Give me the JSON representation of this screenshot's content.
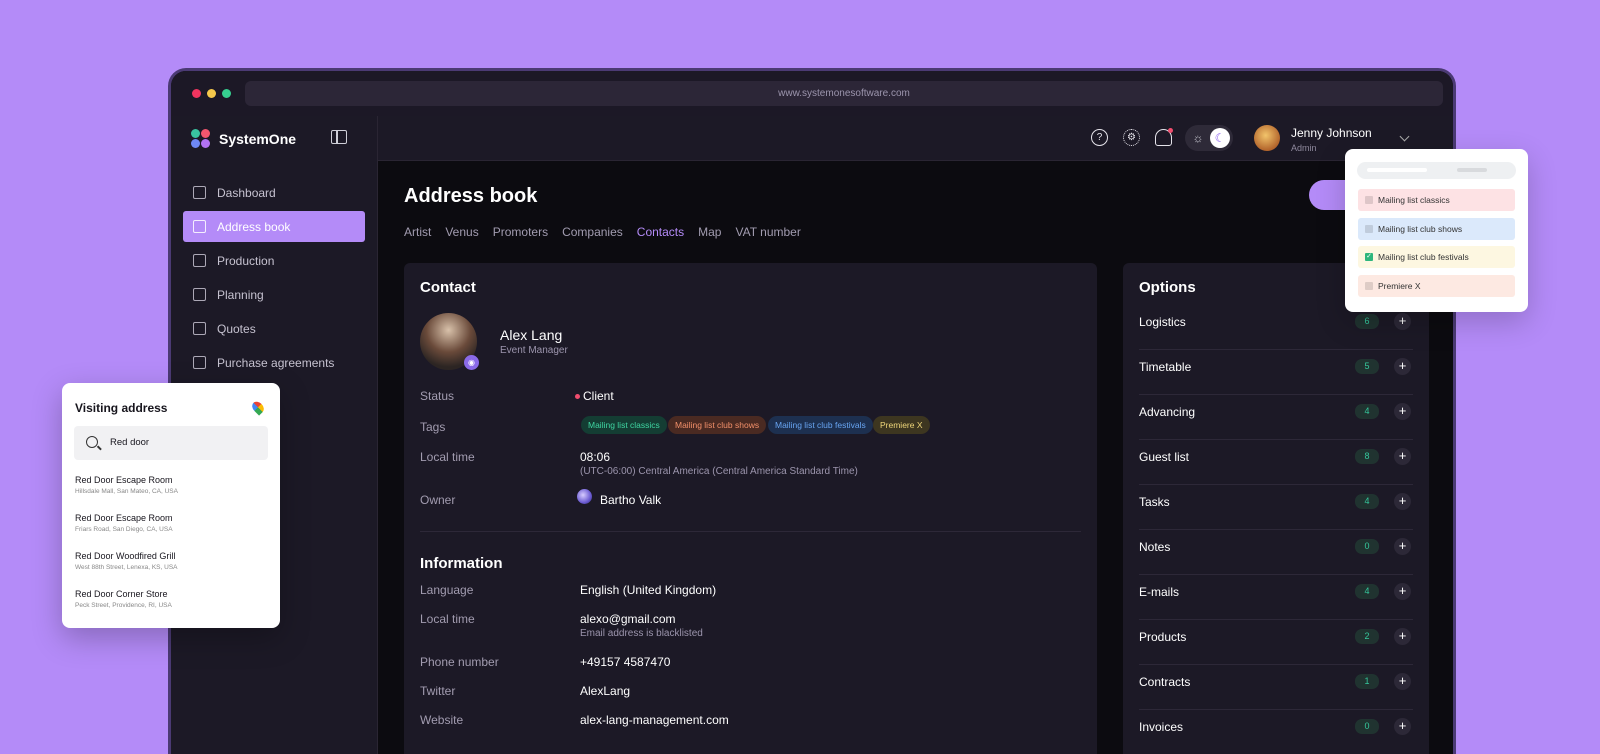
{
  "browser": {
    "url": "www.systemonesoftware.com"
  },
  "app": {
    "name": "SystemOne"
  },
  "sidebar": {
    "items": [
      {
        "label": "Dashboard",
        "icon": "dashboard-icon"
      },
      {
        "label": "Address book",
        "icon": "address-book-icon",
        "active": true
      },
      {
        "label": "Production",
        "icon": "music-note-icon"
      },
      {
        "label": "Planning",
        "icon": "calendar-icon"
      },
      {
        "label": "Quotes",
        "icon": "book-icon"
      },
      {
        "label": "Purchase agreements",
        "icon": "agreement-icon"
      }
    ]
  },
  "topbar": {
    "user_name": "Jenny Johnson",
    "user_role": "Admin",
    "theme": "dark"
  },
  "page": {
    "title": "Address book",
    "tabs": [
      "Artist",
      "Venus",
      "Promoters",
      "Companies",
      "Contacts",
      "Map",
      "VAT number"
    ],
    "active_tab": "Contacts"
  },
  "contact": {
    "section_title": "Contact",
    "name": "Alex Lang",
    "job": "Event Manager",
    "status_label": "Status",
    "status_value": "Client",
    "tags_label": "Tags",
    "tags": [
      {
        "label": "Mailing list classics",
        "bg": "#143d33",
        "fg": "#3fd6a2"
      },
      {
        "label": "Mailing list club shows",
        "bg": "#4a2a22",
        "fg": "#f3906a"
      },
      {
        "label": "Mailing list club festivals",
        "bg": "#1d3050",
        "fg": "#68a5f2"
      },
      {
        "label": "Premiere X",
        "bg": "#3d3620",
        "fg": "#f0d77a"
      }
    ],
    "localtime_label": "Local time",
    "localtime_value": "08:06",
    "localtime_zone": "(UTC-06:00) Central America (Central America Standard Time)",
    "owner_label": "Owner",
    "owner_value": "Bartho Valk"
  },
  "information": {
    "section_title": "Information",
    "rows": [
      {
        "label": "Language",
        "value": "English (United Kingdom)"
      },
      {
        "label": "Local time",
        "value": "alexo@gmail.com",
        "sub": "Email address is blacklisted"
      },
      {
        "label": "Phone number",
        "value": "+49157 4587470"
      },
      {
        "label": "Twitter",
        "value": "AlexLang"
      },
      {
        "label": "Website",
        "value": "alex-lang-management.com"
      }
    ]
  },
  "options": {
    "title": "Options",
    "items": [
      {
        "label": "Logistics",
        "count": "6"
      },
      {
        "label": "Timetable",
        "count": "5"
      },
      {
        "label": "Advancing",
        "count": "4"
      },
      {
        "label": "Guest list",
        "count": "8"
      },
      {
        "label": "Tasks",
        "count": "4"
      },
      {
        "label": "Notes",
        "count": "0"
      },
      {
        "label": "E-mails",
        "count": "4"
      },
      {
        "label": "Products",
        "count": "2"
      },
      {
        "label": "Contracts",
        "count": "1"
      },
      {
        "label": "Invoices",
        "count": "0"
      }
    ]
  },
  "visiting_popup": {
    "title": "Visiting address",
    "search_value": "Red door",
    "results": [
      {
        "name": "Red Door Escape Room",
        "address": "Hillsdale Mall, San Mateo, CA, USA"
      },
      {
        "name": "Red Door Escape Room",
        "address": "Friars Road, San Diego, CA, USA"
      },
      {
        "name": "Red Door Woodfired Grill",
        "address": "West 88th Street, Lenexa, KS, USA"
      },
      {
        "name": "Red Door Corner Store",
        "address": "Peck Street, Providence, RI, USA"
      }
    ]
  },
  "tags_popup": {
    "rows": [
      {
        "label": "Mailing list classics",
        "bg": "#fde2e4",
        "checked": false
      },
      {
        "label": "Mailing list club shows",
        "bg": "#dbe9fb",
        "checked": false
      },
      {
        "label": "Mailing list club festivals",
        "bg": "#fdf7e1",
        "checked": true
      },
      {
        "label": "Premiere X",
        "bg": "#fde9e2",
        "checked": false
      }
    ]
  }
}
